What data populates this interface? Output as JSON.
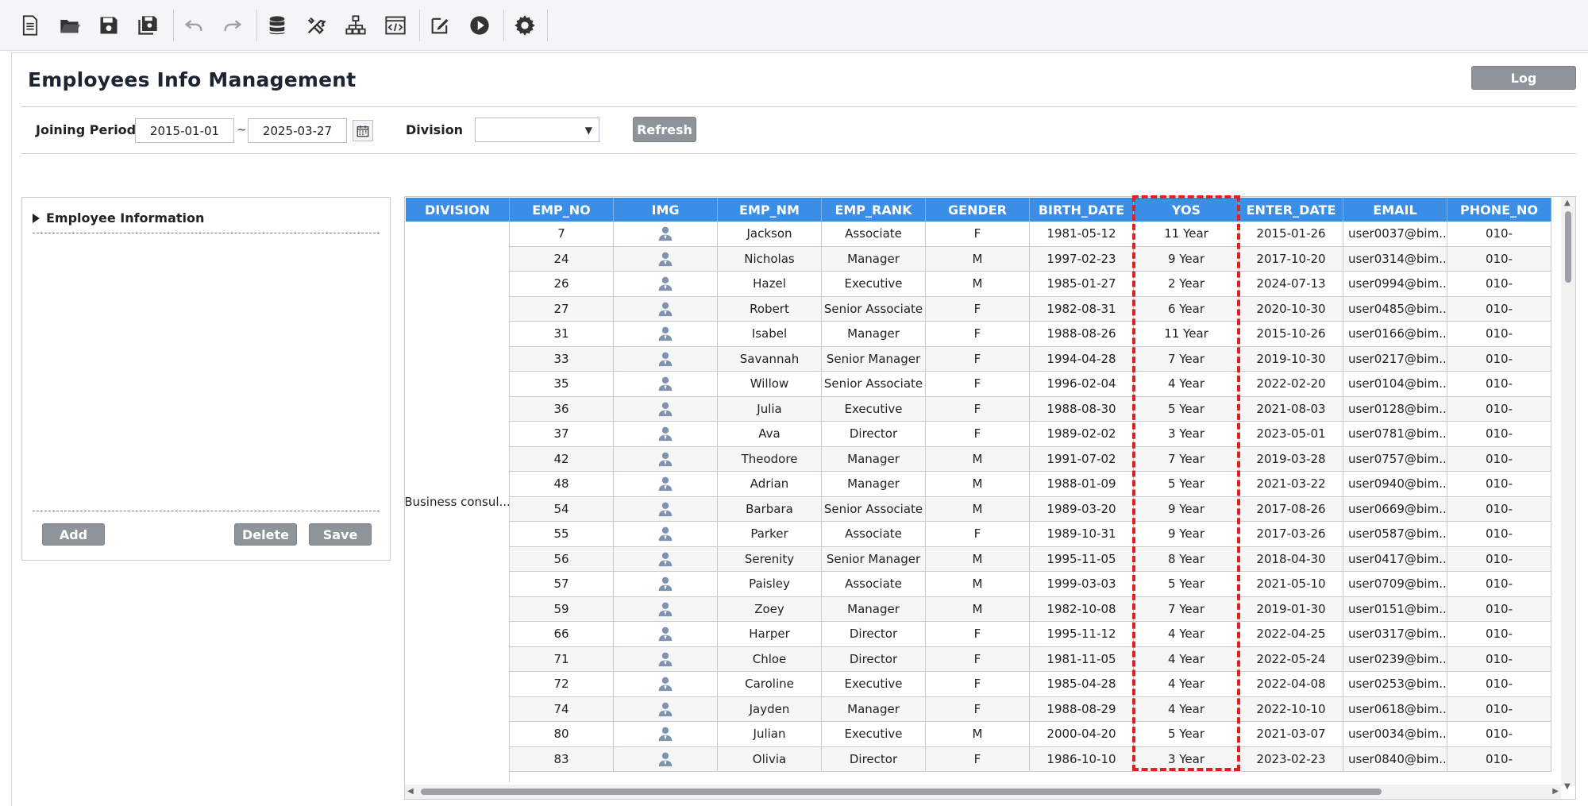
{
  "toolbar": {
    "icons": [
      "new-file-icon",
      "open-folder-icon",
      "save-icon",
      "save-all-icon",
      "undo-icon",
      "redo-icon",
      "database-icon",
      "tools-icon",
      "hierarchy-icon",
      "code-icon",
      "edit-icon",
      "run-icon",
      "settings-icon"
    ]
  },
  "page": {
    "title": "Employees Info Management",
    "log_label": "Log"
  },
  "filters": {
    "joining_period_label": "Joining Period",
    "start_date": "2015-01-01",
    "separator": "~",
    "end_date": "2025-03-27",
    "division_label": "Division",
    "division_value": "",
    "refresh_label": "Refresh"
  },
  "form": {
    "section_title": "Employee Information",
    "add_label": "Add",
    "delete_label": "Delete",
    "save_label": "Save"
  },
  "grid": {
    "columns": [
      "DIVISION",
      "EMP_NO",
      "IMG",
      "EMP_NM",
      "EMP_RANK",
      "GENDER",
      "BIRTH_DATE",
      "YOS",
      "ENTER_DATE",
      "EMAIL",
      "PHONE_NO"
    ],
    "division": "Business consul...",
    "rows": [
      {
        "emp_no": "7",
        "emp_nm": "Jackson",
        "emp_rank": "Associate",
        "gender": "F",
        "birth_date": "1981-05-12",
        "yos": "11 Year",
        "enter_date": "2015-01-26",
        "email": "user0037@bim...",
        "phone_no": "010-"
      },
      {
        "emp_no": "24",
        "emp_nm": "Nicholas",
        "emp_rank": "Manager",
        "gender": "M",
        "birth_date": "1997-02-23",
        "yos": "9 Year",
        "enter_date": "2017-10-20",
        "email": "user0314@bim...",
        "phone_no": "010-"
      },
      {
        "emp_no": "26",
        "emp_nm": "Hazel",
        "emp_rank": "Executive",
        "gender": "M",
        "birth_date": "1985-01-27",
        "yos": "2 Year",
        "enter_date": "2024-07-13",
        "email": "user0994@bim...",
        "phone_no": "010-"
      },
      {
        "emp_no": "27",
        "emp_nm": "Robert",
        "emp_rank": "Senior Associate",
        "gender": "F",
        "birth_date": "1982-08-31",
        "yos": "6 Year",
        "enter_date": "2020-10-30",
        "email": "user0485@bim...",
        "phone_no": "010-"
      },
      {
        "emp_no": "31",
        "emp_nm": "Isabel",
        "emp_rank": "Manager",
        "gender": "F",
        "birth_date": "1988-08-26",
        "yos": "11 Year",
        "enter_date": "2015-10-26",
        "email": "user0166@bim...",
        "phone_no": "010-"
      },
      {
        "emp_no": "33",
        "emp_nm": "Savannah",
        "emp_rank": "Senior Manager",
        "gender": "F",
        "birth_date": "1994-04-28",
        "yos": "7 Year",
        "enter_date": "2019-10-30",
        "email": "user0217@bim...",
        "phone_no": "010-"
      },
      {
        "emp_no": "35",
        "emp_nm": "Willow",
        "emp_rank": "Senior Associate",
        "gender": "F",
        "birth_date": "1996-02-04",
        "yos": "4 Year",
        "enter_date": "2022-02-20",
        "email": "user0104@bim...",
        "phone_no": "010-"
      },
      {
        "emp_no": "36",
        "emp_nm": "Julia",
        "emp_rank": "Executive",
        "gender": "F",
        "birth_date": "1988-08-30",
        "yos": "5 Year",
        "enter_date": "2021-08-03",
        "email": "user0128@bim...",
        "phone_no": "010-"
      },
      {
        "emp_no": "37",
        "emp_nm": "Ava",
        "emp_rank": "Director",
        "gender": "F",
        "birth_date": "1989-02-02",
        "yos": "3 Year",
        "enter_date": "2023-05-01",
        "email": "user0781@bim...",
        "phone_no": "010-"
      },
      {
        "emp_no": "42",
        "emp_nm": "Theodore",
        "emp_rank": "Manager",
        "gender": "M",
        "birth_date": "1991-07-02",
        "yos": "7 Year",
        "enter_date": "2019-03-28",
        "email": "user0757@bim...",
        "phone_no": "010-"
      },
      {
        "emp_no": "48",
        "emp_nm": "Adrian",
        "emp_rank": "Manager",
        "gender": "M",
        "birth_date": "1988-01-09",
        "yos": "5 Year",
        "enter_date": "2021-03-22",
        "email": "user0940@bim...",
        "phone_no": "010-"
      },
      {
        "emp_no": "54",
        "emp_nm": "Barbara",
        "emp_rank": "Senior Associate",
        "gender": "M",
        "birth_date": "1989-03-20",
        "yos": "9 Year",
        "enter_date": "2017-08-26",
        "email": "user0669@bim...",
        "phone_no": "010-"
      },
      {
        "emp_no": "55",
        "emp_nm": "Parker",
        "emp_rank": "Associate",
        "gender": "F",
        "birth_date": "1989-10-31",
        "yos": "9 Year",
        "enter_date": "2017-03-26",
        "email": "user0587@bim...",
        "phone_no": "010-"
      },
      {
        "emp_no": "56",
        "emp_nm": "Serenity",
        "emp_rank": "Senior Manager",
        "gender": "M",
        "birth_date": "1995-11-05",
        "yos": "8 Year",
        "enter_date": "2018-04-30",
        "email": "user0417@bim...",
        "phone_no": "010-"
      },
      {
        "emp_no": "57",
        "emp_nm": "Paisley",
        "emp_rank": "Associate",
        "gender": "M",
        "birth_date": "1999-03-03",
        "yos": "5 Year",
        "enter_date": "2021-05-10",
        "email": "user0709@bim...",
        "phone_no": "010-"
      },
      {
        "emp_no": "59",
        "emp_nm": "Zoey",
        "emp_rank": "Manager",
        "gender": "M",
        "birth_date": "1982-10-08",
        "yos": "7 Year",
        "enter_date": "2019-01-30",
        "email": "user0151@bim...",
        "phone_no": "010-"
      },
      {
        "emp_no": "66",
        "emp_nm": "Harper",
        "emp_rank": "Director",
        "gender": "F",
        "birth_date": "1995-11-12",
        "yos": "4 Year",
        "enter_date": "2022-04-25",
        "email": "user0317@bim...",
        "phone_no": "010-"
      },
      {
        "emp_no": "71",
        "emp_nm": "Chloe",
        "emp_rank": "Director",
        "gender": "F",
        "birth_date": "1981-11-05",
        "yos": "4 Year",
        "enter_date": "2022-05-24",
        "email": "user0239@bim...",
        "phone_no": "010-"
      },
      {
        "emp_no": "72",
        "emp_nm": "Caroline",
        "emp_rank": "Executive",
        "gender": "F",
        "birth_date": "1985-04-28",
        "yos": "4 Year",
        "enter_date": "2022-04-08",
        "email": "user0253@bim...",
        "phone_no": "010-"
      },
      {
        "emp_no": "74",
        "emp_nm": "Jayden",
        "emp_rank": "Manager",
        "gender": "F",
        "birth_date": "1988-08-29",
        "yos": "4 Year",
        "enter_date": "2022-10-10",
        "email": "user0618@bim...",
        "phone_no": "010-"
      },
      {
        "emp_no": "80",
        "emp_nm": "Julian",
        "emp_rank": "Executive",
        "gender": "M",
        "birth_date": "2000-04-20",
        "yos": "5 Year",
        "enter_date": "2021-03-07",
        "email": "user0034@bim...",
        "phone_no": "010-"
      },
      {
        "emp_no": "83",
        "emp_nm": "Olivia",
        "emp_rank": "Director",
        "gender": "F",
        "birth_date": "1986-10-10",
        "yos": "3 Year",
        "enter_date": "2023-02-23",
        "email": "user0840@bim...",
        "phone_no": "010-"
      }
    ]
  },
  "colors": {
    "header_bg": "#3a8ee6",
    "button_bg": "#8f949b",
    "highlight": "#e02020"
  }
}
